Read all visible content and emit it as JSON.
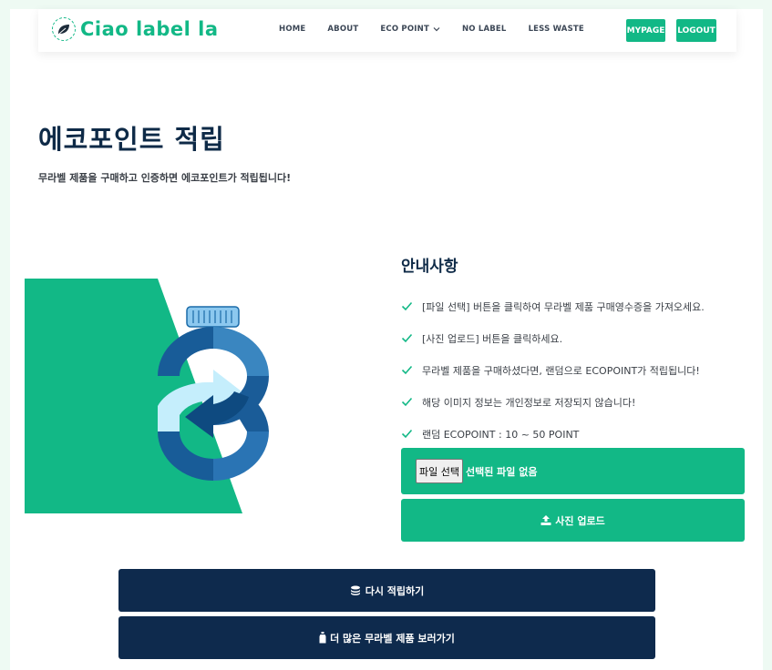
{
  "brand": {
    "name": "Ciao label la",
    "logo_icon": "leaf-icon"
  },
  "nav": {
    "home": "HOME",
    "about": "ABOUT",
    "eco_point": "ECO POINT",
    "no_label": "NO LABEL",
    "less_waste": "LESS WASTE",
    "mypage": "MYPAGE",
    "logout": "LOGOUT"
  },
  "hero": {
    "title": "에코포인트 적립",
    "subtitle": "무라벨 제품을 구매하고 인증하면 에코포인트가 적립됩니다!"
  },
  "guide": {
    "title": "안내사항",
    "items": [
      "[파일 선택] 버튼을 클릭하여 무라벨 제품 구매영수증을 가져오세요.",
      "[사진 업로드] 버튼을 클릭하세요.",
      "무라벨 제품을 구매하셨다면, 랜덤으로 ECOPOINT가 적립됩니다!",
      "해당 이미지 정보는 개인정보로 저장되지 않습니다!",
      "랜덤 ECOPOINT : 10 ~ 50 POINT"
    ]
  },
  "upload": {
    "file_button": "파일 선택",
    "file_status": "선택된 파일 없음",
    "upload_button": "사진 업로드"
  },
  "actions": {
    "retry": "다시 적립하기",
    "more_products": "더 많은 무라벨 제품 보러가기"
  },
  "colors": {
    "accent": "#12b886",
    "navy": "#0e2a4d",
    "blue": "#1a6aa8",
    "light_blue": "#c5eefc"
  }
}
